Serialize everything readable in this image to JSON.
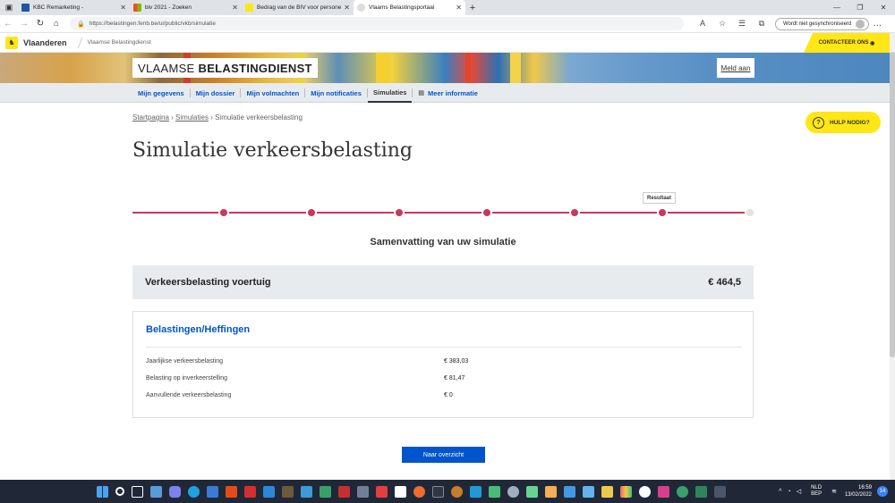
{
  "browser": {
    "tabs": [
      {
        "label": "KBC Remarketing -",
        "favicon_color": "#1e56a0"
      },
      {
        "label": "biv 2021 - Zoeken",
        "favicon_color": "#f25022"
      },
      {
        "label": "Bedrag van de BIV voor persone",
        "favicon_color": "#ffe615"
      },
      {
        "label": "Vlaams Belastingsportaal",
        "favicon_color": "#dddddd"
      }
    ],
    "url": "https://belastingen.fenb.be/ui/public/vkb/simulatie",
    "profile_label": "Wordt niet gesynchroniseerd"
  },
  "site": {
    "brand": "Vlaanderen",
    "subbrand": "Vlaamse Belastingdienst",
    "contact_label": "CONTACTEER ONS",
    "banner_title_a": "VLAAMSE",
    "banner_title_b": "BELASTINGDIENST",
    "login_label": "Meld aan",
    "nav": [
      {
        "label": "Mijn gegevens"
      },
      {
        "label": "Mijn dossier"
      },
      {
        "label": "Mijn volmachten"
      },
      {
        "label": "Mijn notificaties"
      },
      {
        "label": "Simulaties"
      },
      {
        "label": "Meer informatie"
      }
    ],
    "help_label": "HULP NODIG?"
  },
  "breadcrumb": {
    "home": "Startpagina",
    "section": "Simulaties",
    "current": "Simulatie verkeersbelasting"
  },
  "page": {
    "title": "Simulatie verkeersbelasting",
    "step_tooltip": "Resultaat",
    "steps_total": 8,
    "steps_completed": 7,
    "summary_title": "Samenvatting van uw simulatie",
    "total_label": "Verkeersbelasting voertuig",
    "total_value": "€ 464,5",
    "detail_title": "Belastingen/Heffingen",
    "rows": [
      {
        "label": "Jaarlijkse verkeersbelasting",
        "value": "€ 383,03"
      },
      {
        "label": "Belasting op inverkeerstelling",
        "value": "€ 81,47"
      },
      {
        "label": "Aanvullende verkeersbelasting",
        "value": "€ 0"
      }
    ],
    "button_label": "Naar overzicht"
  },
  "taskbar": {
    "lang_a": "NLD",
    "lang_b": "BEP",
    "time": "16:59",
    "date": "13/02/2022",
    "notif_count": "14"
  },
  "colors": {
    "accent_yellow": "#ffe615",
    "link_blue": "#0055cc",
    "step_done": "#c8385a",
    "step_todo": "#e2e2e2"
  }
}
